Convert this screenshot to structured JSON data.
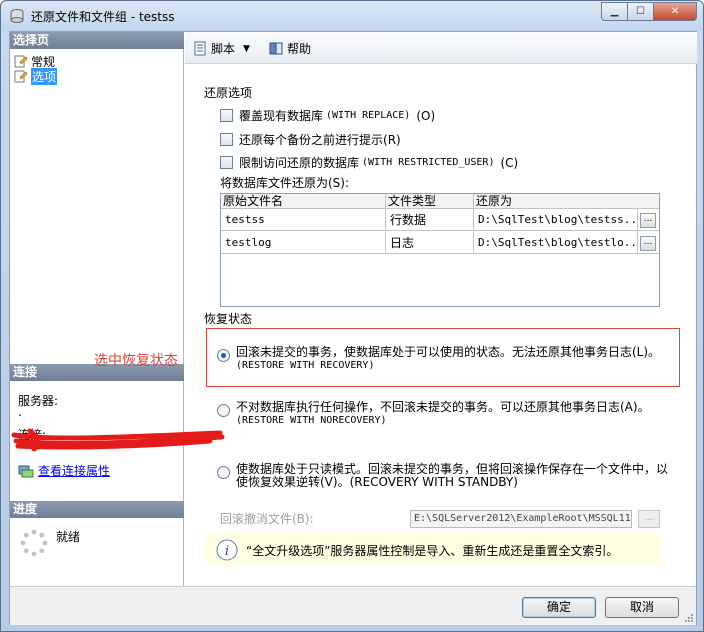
{
  "window": {
    "title": "还原文件和文件组 - testss"
  },
  "left": {
    "select_page_header": "选择页",
    "pages": [
      {
        "label": "常规",
        "selected": false
      },
      {
        "label": "选项",
        "selected": true
      }
    ],
    "connection_header": "连接",
    "server_label": "服务器:",
    "server_value": ".",
    "connection_label": "连接:",
    "view_connection_link": "查看连接属性",
    "progress_header": "进度",
    "progress_status": "就绪"
  },
  "toolbar": {
    "script_label": "脚本",
    "help_label": "帮助"
  },
  "restore_options": {
    "title": "还原选项",
    "options": [
      {
        "text": "覆盖现有数据库",
        "code": "(WITH REPLACE)",
        "key": "(O)",
        "checked": false
      },
      {
        "text": "还原每个备份之前进行提示",
        "code": "",
        "key": "(R)",
        "checked": false
      },
      {
        "text": "限制访问还原的数据库",
        "code": "(WITH RESTRICTED_USER)",
        "key": "(C)",
        "checked": false
      }
    ],
    "restore_as_label": "将数据库文件还原为(S):",
    "columns": [
      "原始文件名",
      "文件类型",
      "还原为"
    ],
    "rows": [
      {
        "original": "testss",
        "type": "行数据",
        "restore_as": "D:\\SqlTest\\blog\\testss..."
      },
      {
        "original": "testlog",
        "type": "日志",
        "restore_as": "D:\\SqlTest\\blog\\testlo..."
      }
    ],
    "browse_label": "..."
  },
  "recovery_state": {
    "title": "恢复状态",
    "annotation": "选中恢复状态",
    "options": [
      {
        "line1": "回滚未提交的事务，使数据库处于可以使用的状态。无法还原其他事务日志(L)。",
        "line2": "(RESTORE WITH RECOVERY)",
        "selected": true
      },
      {
        "line1": "不对数据库执行任何操作，不回滚未提交的事务。可以还原其他事务日志(A)。",
        "line2": "(RESTORE WITH NORECOVERY)",
        "selected": false
      },
      {
        "line1": "使数据库处于只读模式。回滚未提交的事务，但将回滚操作保存在一个文件中，以",
        "line2": "使恢复效果逆转(V)。(RECOVERY WITH STANDBY)",
        "selected": false
      }
    ],
    "undo_file_label": "回滚撤消文件(B):",
    "undo_file_value": "E:\\SQLServer2012\\ExampleRoot\\MSSQL11",
    "undo_browse_label": "...",
    "info_text": "“全文升级选项”服务器属性控制是导入、重新生成还是重置全文索引。"
  },
  "footer": {
    "ok_label": "确定",
    "cancel_label": "取消"
  },
  "colors": {
    "annotation_red": "#d9463b",
    "selection_blue": "#3399ff",
    "link_blue": "#0000ee"
  }
}
